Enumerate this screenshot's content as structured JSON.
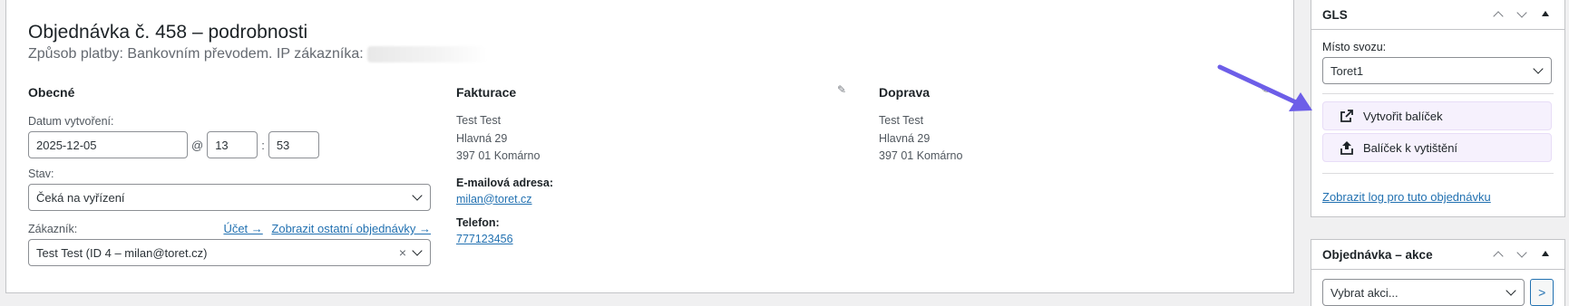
{
  "order": {
    "title": "Objednávka č. 458 – podrobnosti",
    "subtitle": "Způsob platby: Bankovním převodem. IP zákazníka:"
  },
  "general": {
    "heading": "Obecné",
    "date_label": "Datum vytvoření:",
    "date_value": "2025-12-05",
    "at": "@",
    "hour": "13",
    "colon": ":",
    "minute": "53",
    "status_label": "Stav:",
    "status_value": "Čeká na vyřízení",
    "customer_label": "Zákazník:",
    "account_link": "Účet →",
    "other_orders_link": "Zobrazit ostatní objednávky →",
    "customer_value": "Test Test (ID 4 – milan@toret.cz)",
    "clear": "×"
  },
  "billing": {
    "heading": "Fakturace",
    "lines": [
      "Test Test",
      "Hlavná 29",
      "397 01 Komárno"
    ],
    "email_label": "E-mailová adresa:",
    "email": "milan@toret.cz",
    "phone_label": "Telefon:",
    "phone": "777123456"
  },
  "shipping": {
    "heading": "Doprava",
    "lines": [
      "Test Test",
      "Hlavná 29",
      "397 01 Komárno"
    ]
  },
  "icons": {
    "edit": "pencil-icon"
  },
  "gls": {
    "title": "GLS",
    "pickup_label": "Místo svozu:",
    "pickup_value": "Toret1",
    "create_button": "Vytvořit balíček",
    "print_button": "Balíček k vytištění",
    "log_link": "Zobrazit log pro tuto objednávku"
  },
  "order_actions": {
    "title": "Objednávka – akce",
    "select_value": "Vybrat akci...",
    "go": ">"
  },
  "colors": {
    "link": "#2271b1",
    "gls_button_bg": "#f6f1fd",
    "arrow": "#6d5ee8"
  }
}
